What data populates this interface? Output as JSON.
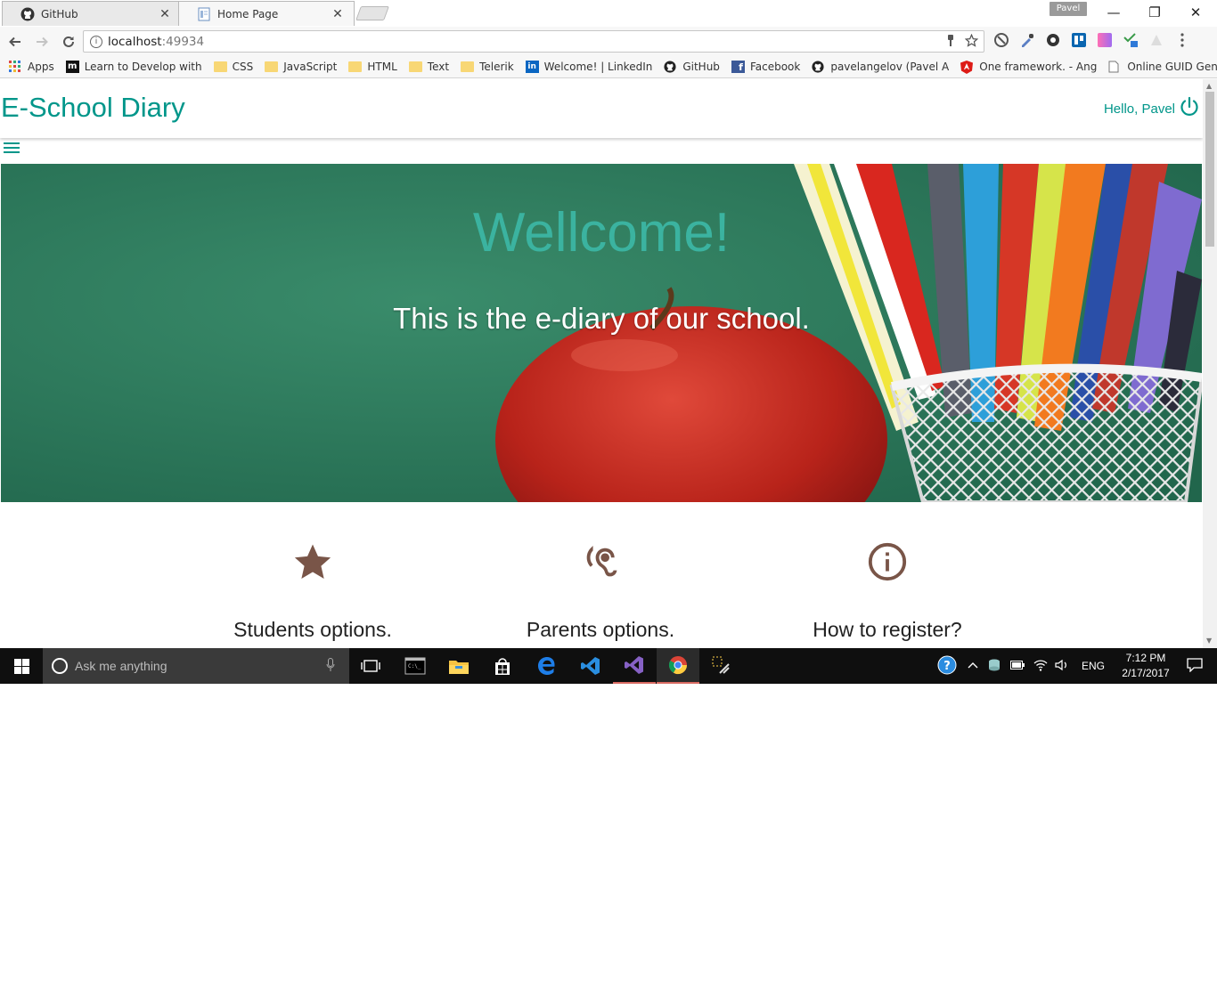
{
  "browser": {
    "tabs": [
      {
        "title": "GitHub",
        "close": "✕"
      },
      {
        "title": "Home Page",
        "close": "✕"
      }
    ],
    "profile_name": "Pavel",
    "window_controls": {
      "minimize": "—",
      "restore": "❐",
      "close": "✕"
    },
    "url_host": "localhost",
    "url_port": ":49934",
    "bookmarks": [
      {
        "label": "Apps",
        "icon": "apps-grid-icon"
      },
      {
        "label": "Learn to Develop with",
        "icon": "m-logo-icon"
      },
      {
        "label": "CSS",
        "icon": "folder-icon"
      },
      {
        "label": "JavaScript",
        "icon": "folder-icon"
      },
      {
        "label": "HTML",
        "icon": "folder-icon"
      },
      {
        "label": "Text",
        "icon": "folder-icon"
      },
      {
        "label": "Telerik",
        "icon": "folder-icon"
      },
      {
        "label": "Welcome! | LinkedIn",
        "icon": "linkedin-icon"
      },
      {
        "label": "GitHub",
        "icon": "github-icon"
      },
      {
        "label": "Facebook",
        "icon": "facebook-icon"
      },
      {
        "label": "pavelangelov (Pavel A",
        "icon": "github-icon"
      },
      {
        "label": "One framework. - Ang",
        "icon": "angular-icon"
      },
      {
        "label": "Online GUID Generat",
        "icon": "page-icon"
      }
    ]
  },
  "site": {
    "brand": "E-School Diary",
    "greeting": "Hello, Pavel",
    "hero_title": "Wellcome!",
    "hero_subtitle": "This is the e-diary of our school.",
    "features": [
      {
        "label": "Students options.",
        "icon": "star-icon"
      },
      {
        "label": "Parents options.",
        "icon": "hearing-icon"
      },
      {
        "label": "How to register?",
        "icon": "info-icon"
      }
    ],
    "colors": {
      "accent": "#00968a",
      "icon_brown": "#795548",
      "hero_green": "#2f7a5c"
    }
  },
  "taskbar": {
    "search_placeholder": "Ask me anything",
    "language": "ENG",
    "time": "7:12 PM",
    "date": "2/17/2017"
  }
}
